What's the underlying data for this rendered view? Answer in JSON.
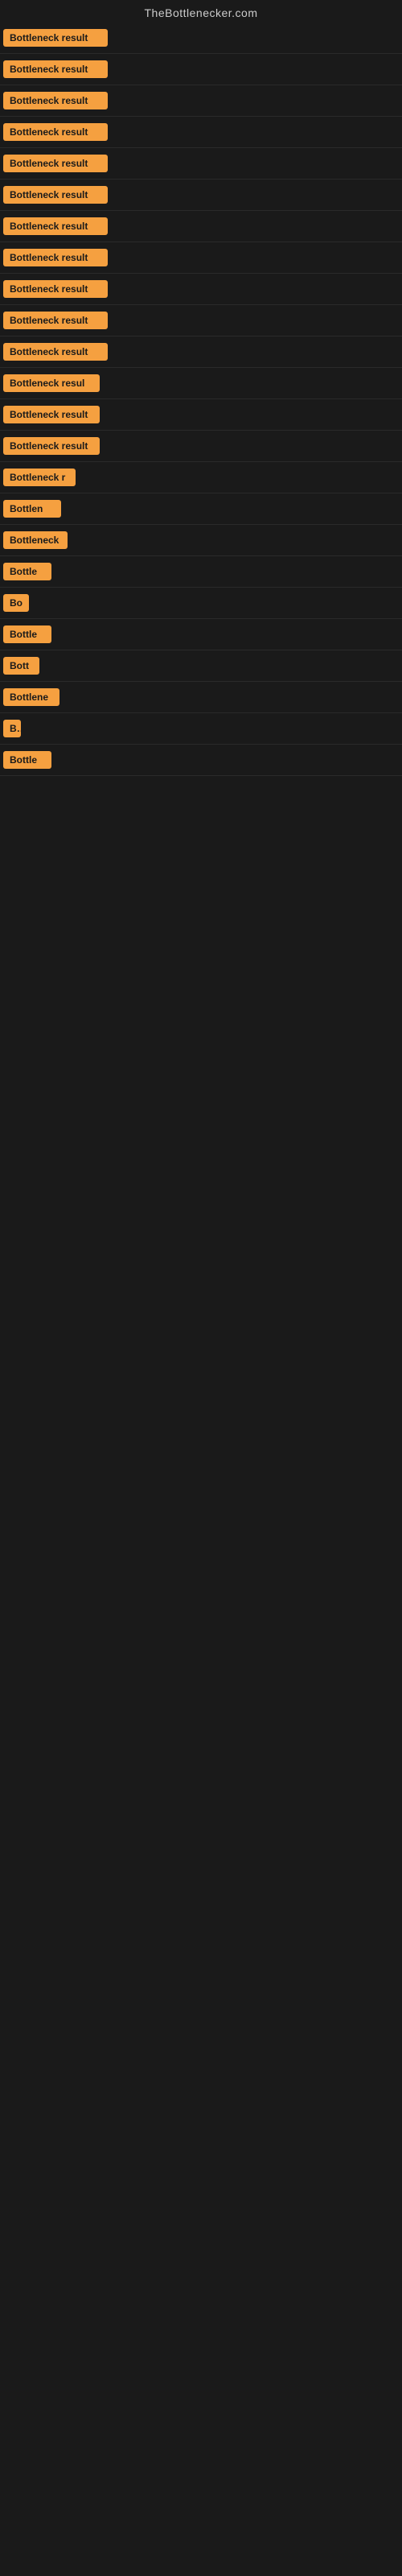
{
  "header": {
    "title": "TheBottlenecker.com"
  },
  "rows": [
    {
      "id": 1,
      "label": "Bottleneck result",
      "width": 130
    },
    {
      "id": 2,
      "label": "Bottleneck result",
      "width": 130
    },
    {
      "id": 3,
      "label": "Bottleneck result",
      "width": 130
    },
    {
      "id": 4,
      "label": "Bottleneck result",
      "width": 130
    },
    {
      "id": 5,
      "label": "Bottleneck result",
      "width": 130
    },
    {
      "id": 6,
      "label": "Bottleneck result",
      "width": 130
    },
    {
      "id": 7,
      "label": "Bottleneck result",
      "width": 130
    },
    {
      "id": 8,
      "label": "Bottleneck result",
      "width": 130
    },
    {
      "id": 9,
      "label": "Bottleneck result",
      "width": 130
    },
    {
      "id": 10,
      "label": "Bottleneck result",
      "width": 130
    },
    {
      "id": 11,
      "label": "Bottleneck result",
      "width": 130
    },
    {
      "id": 12,
      "label": "Bottleneck resul",
      "width": 120
    },
    {
      "id": 13,
      "label": "Bottleneck result",
      "width": 120
    },
    {
      "id": 14,
      "label": "Bottleneck result",
      "width": 120
    },
    {
      "id": 15,
      "label": "Bottleneck r",
      "width": 90
    },
    {
      "id": 16,
      "label": "Bottlen",
      "width": 72
    },
    {
      "id": 17,
      "label": "Bottleneck",
      "width": 80
    },
    {
      "id": 18,
      "label": "Bottle",
      "width": 60
    },
    {
      "id": 19,
      "label": "Bo",
      "width": 32
    },
    {
      "id": 20,
      "label": "Bottle",
      "width": 60
    },
    {
      "id": 21,
      "label": "Bott",
      "width": 45
    },
    {
      "id": 22,
      "label": "Bottlene",
      "width": 70
    },
    {
      "id": 23,
      "label": "B",
      "width": 22
    },
    {
      "id": 24,
      "label": "Bottle",
      "width": 60
    }
  ],
  "colors": {
    "badge_bg": "#f5a040",
    "badge_text": "#1a1a1a",
    "bg": "#1a1a1a",
    "title_text": "#cccccc"
  }
}
